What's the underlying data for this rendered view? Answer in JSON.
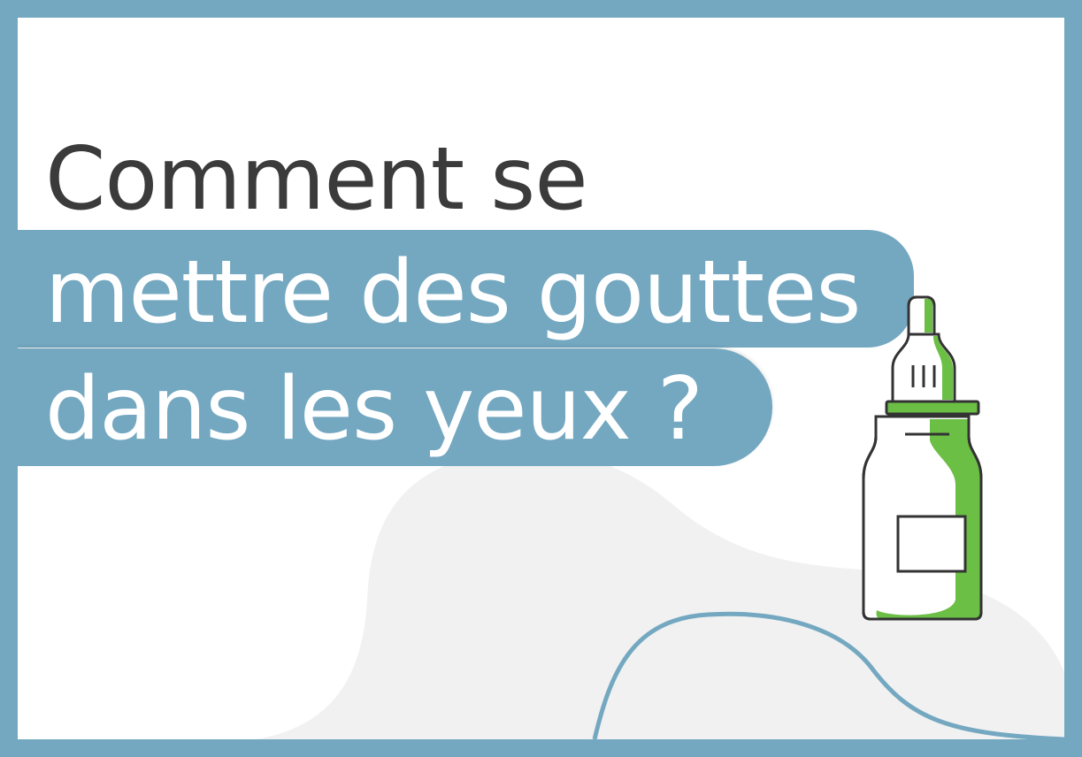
{
  "title": {
    "line1": "Comment se",
    "line2": "mettre des gouttes",
    "line3": "dans les yeux ?"
  },
  "colors": {
    "frame": "#74a8c1",
    "band": "#74a8c1",
    "title_dark": "#3b3b3b",
    "title_light": "#ffffff",
    "bottle_green": "#6bbf45",
    "blob_gray": "#f1f1f1"
  },
  "icons": {
    "illustration": "eye-drop-bottle-icon"
  }
}
